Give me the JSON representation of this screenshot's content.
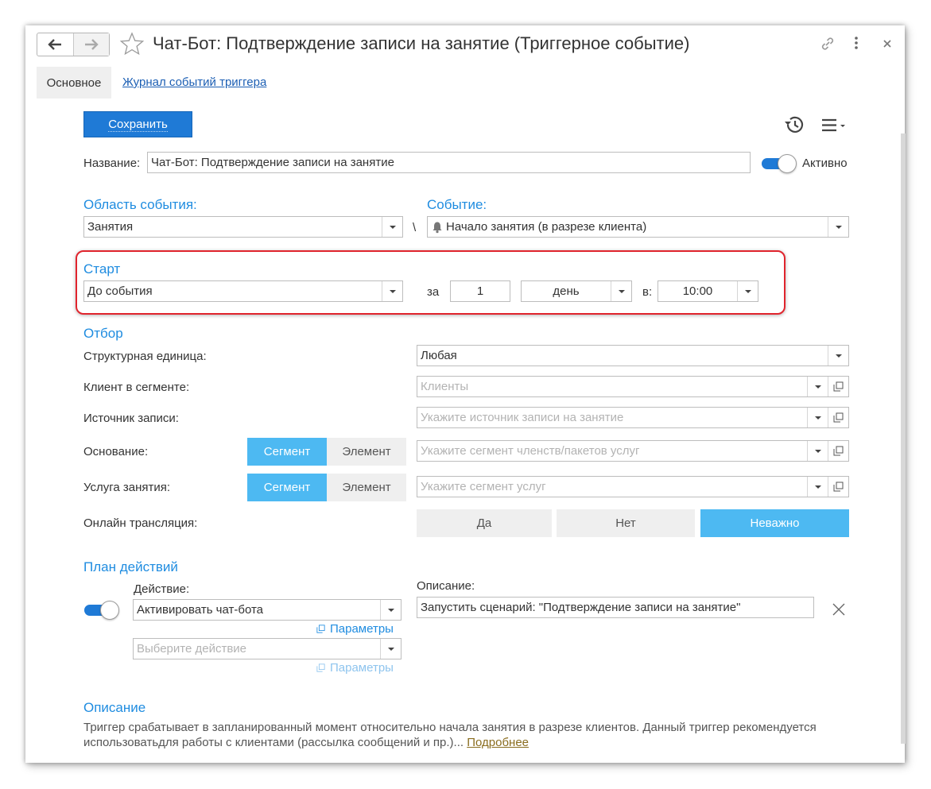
{
  "window": {
    "title": "Чат-Бот: Подтверждение записи на занятие (Триггерное событие)"
  },
  "tabs": {
    "main": "Основное",
    "log": "Журнал событий триггера"
  },
  "toolbar": {
    "save_label": "Сохранить"
  },
  "name_row": {
    "label": "Название:",
    "value": "Чат-Бот: Подтверждение записи на занятие",
    "active_label": "Активно",
    "active": true
  },
  "event": {
    "area_label": "Область события:",
    "area_value": "Занятия",
    "separator": "\\",
    "event_label": "Событие:",
    "event_value": "Начало занятия  (в разрезе клиента)"
  },
  "start": {
    "label": "Старт",
    "mode": "До события",
    "za_label": "за",
    "amount": "1",
    "unit": "день",
    "at_label": "в:",
    "time": "10:00"
  },
  "filter": {
    "label": "Отбор",
    "unit_label": "Структурная единица:",
    "unit_value": "Любая",
    "client_label": "Клиент в сегменте:",
    "client_placeholder": "Клиенты",
    "source_label": "Источник записи:",
    "source_placeholder": "Укажите источник записи на занятие",
    "basis_label": "Основание:",
    "basis_segment": "Сегмент",
    "basis_element": "Элемент",
    "basis_placeholder": "Укажите сегмент членств/пакетов услуг",
    "service_label": "Услуга занятия:",
    "service_segment": "Сегмент",
    "service_element": "Элемент",
    "service_placeholder": "Укажите сегмент услуг",
    "online_label": "Онлайн трансляция:",
    "online_yes": "Да",
    "online_no": "Нет",
    "online_any": "Неважно"
  },
  "plan": {
    "label": "План действий",
    "action_label": "Действие:",
    "action_value": "Активировать чат-бота",
    "params_label": "Параметры",
    "action2_placeholder": "Выберите действие",
    "params2_label": "Параметры",
    "desc_label": "Описание:",
    "desc_value": "Запустить сценарий: \"Подтверждение записи на занятие\""
  },
  "description": {
    "label": "Описание",
    "text": "Триггер срабатывает в запланированный момент относительно начала занятия в разрезе клиентов. Данный триггер рекомендуется использоватьдля работы с клиентами (рассылка сообщений и пр.)...",
    "more": "Подробнее"
  },
  "colors": {
    "accent": "#1f7ad6",
    "section": "#1f8ce0",
    "segment_on": "#4db9f2",
    "highlight": "#e0242d"
  }
}
